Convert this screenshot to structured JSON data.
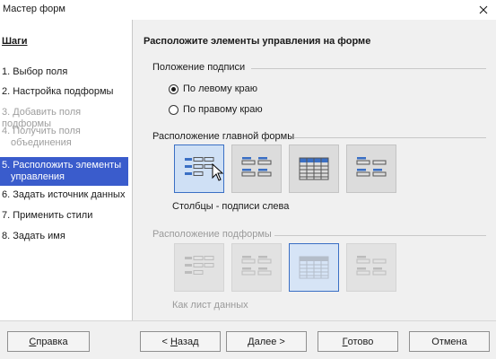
{
  "window": {
    "title": "Мастер форм",
    "close_glyph": "✕"
  },
  "sidebar": {
    "title": "Шаги",
    "items": [
      {
        "label": "1. Выбор поля",
        "state": "normal"
      },
      {
        "label": "2. Настройка подформы",
        "state": "normal"
      },
      {
        "label": "3. Добавить поля подформы",
        "state": "disabled"
      },
      {
        "label": "4. Получить поля объединения",
        "state": "disabled"
      },
      {
        "label": "5. Расположить элементы управления",
        "state": "active"
      },
      {
        "label": "6. Задать источник данных",
        "state": "normal"
      },
      {
        "label": "7. Применить стили",
        "state": "normal"
      },
      {
        "label": "8. Задать имя",
        "state": "normal"
      }
    ]
  },
  "main": {
    "title": "Расположите элементы управления на форме",
    "label_position": {
      "title": "Положение подписи",
      "options": [
        {
          "label": "По левому краю",
          "checked": true
        },
        {
          "label": "По правому краю",
          "checked": false
        }
      ]
    },
    "main_form_layout": {
      "title": "Расположение главной формы",
      "selected_caption": "Столбцы - подписи слева",
      "selected_index": 0
    },
    "subform_layout": {
      "title": "Расположение подформы",
      "selected_caption": "Как лист данных",
      "selected_index": 2
    }
  },
  "footer": {
    "help": {
      "mnemonic": "С",
      "rest": "правка"
    },
    "back": {
      "prefix": "< ",
      "mnemonic": "Н",
      "rest": "азад"
    },
    "next": {
      "mnemonic": "Д",
      "rest": "алее >"
    },
    "finish": {
      "mnemonic": "Г",
      "rest": "отово"
    },
    "cancel": {
      "label": "Отмена"
    }
  },
  "colors": {
    "accent": "#3a5ccc",
    "selected_bg": "#cfe0f5",
    "selected_border": "#3a6fc4",
    "disabled_text": "#9e9e9e"
  }
}
